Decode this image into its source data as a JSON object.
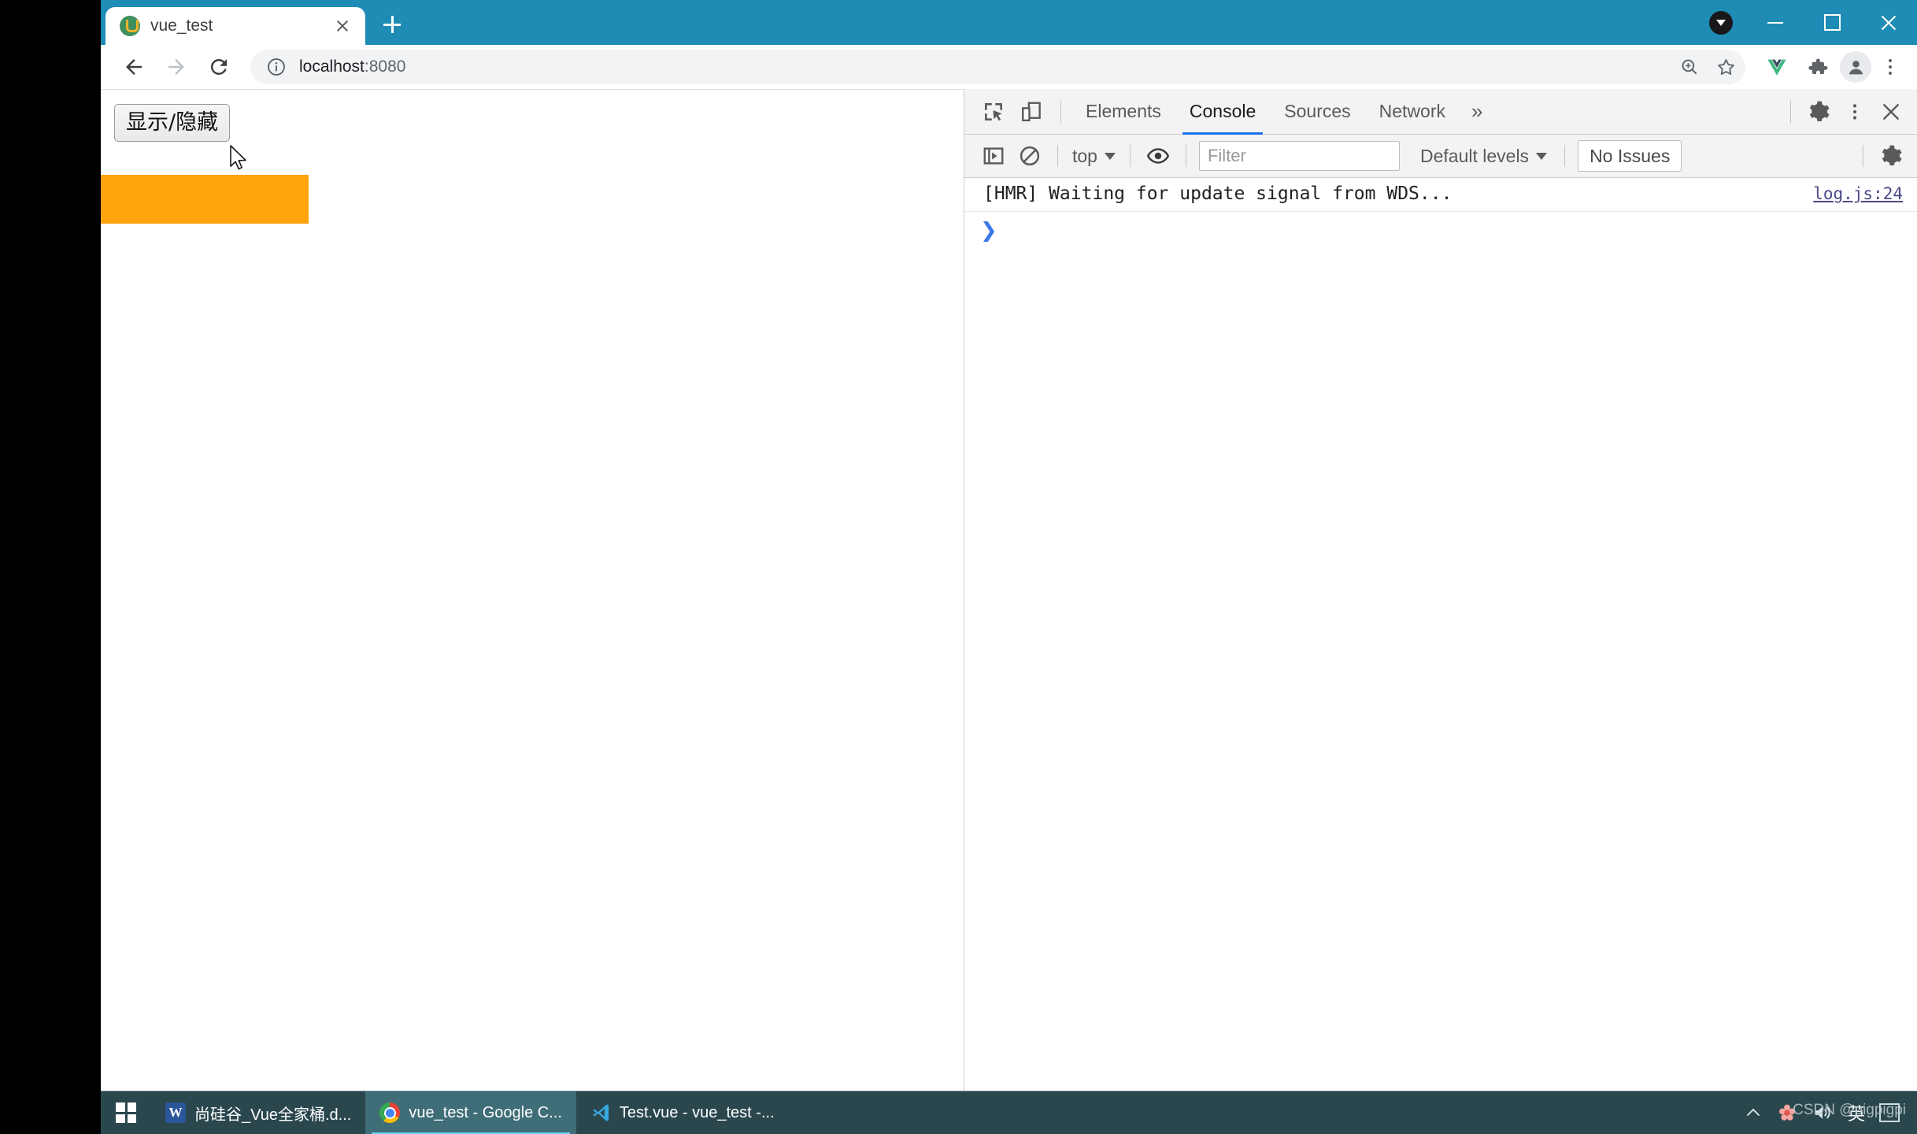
{
  "browser": {
    "tab": {
      "title": "vue_test",
      "favicon": "vue-logo-icon",
      "close_label": "close-tab"
    },
    "new_tab_label": "new-tab",
    "window_controls": {
      "download": "download-indicator",
      "minimize": "minimize",
      "maximize": "maximize",
      "close": "close"
    },
    "toolbar": {
      "back": "back-arrow-icon",
      "forward": "forward-arrow-icon",
      "reload": "reload-icon",
      "site_info": "info-circle-icon",
      "url": "localhost",
      "url_port": ":8080",
      "zoom_icon": "zoom-magnifier-icon",
      "bookmark_icon": "star-icon",
      "vue_devtools_icon": "vue-extension-icon",
      "extensions_icon": "puzzle-piece-icon",
      "profile_icon": "profile-avatar-icon",
      "menu_icon": "three-dot-menu-icon"
    }
  },
  "page": {
    "button_label": "显示/隐藏",
    "box_color": "#ffa40d"
  },
  "devtools": {
    "inspect_icon": "inspect-element-icon",
    "device_icon": "device-toolbar-icon",
    "tabs": [
      {
        "label": "Elements",
        "active": false
      },
      {
        "label": "Console",
        "active": true
      },
      {
        "label": "Sources",
        "active": false
      },
      {
        "label": "Network",
        "active": false
      }
    ],
    "more_tabs_label": "»",
    "settings_icon": "gear-icon",
    "more_options_icon": "three-dot-menu-icon",
    "close_icon": "close-icon",
    "console_toolbar": {
      "sidebar_toggle_icon": "console-sidebar-icon",
      "clear_icon": "clear-console-icon",
      "context": "top",
      "eye_icon": "live-expression-eye-icon",
      "filter_placeholder": "Filter",
      "levels": "Default levels",
      "issues": "No Issues",
      "settings_icon": "gear-icon"
    },
    "console_messages": [
      {
        "text": "[HMR] Waiting for update signal from WDS...",
        "source": "log.js:24"
      }
    ],
    "prompt_caret": "❯",
    "accent_color": "#1a73e8"
  },
  "taskbar": {
    "start_label": "start-button",
    "items": [
      {
        "label": "尚硅谷_Vue全家桶.d...",
        "icon": "word-icon",
        "active": false
      },
      {
        "label": "vue_test - Google C...",
        "icon": "chrome-icon",
        "active": true
      },
      {
        "label": "Test.vue - vue_test -...",
        "icon": "vscode-icon",
        "active": false
      }
    ],
    "tray": {
      "chevron": "⌃",
      "flower_icon": "tray-flower-icon",
      "volume_icon": "volume-speaker-icon",
      "ime": "英",
      "box_icon": "ime-box-icon"
    },
    "watermark": "CSDN @pigpigpi"
  }
}
